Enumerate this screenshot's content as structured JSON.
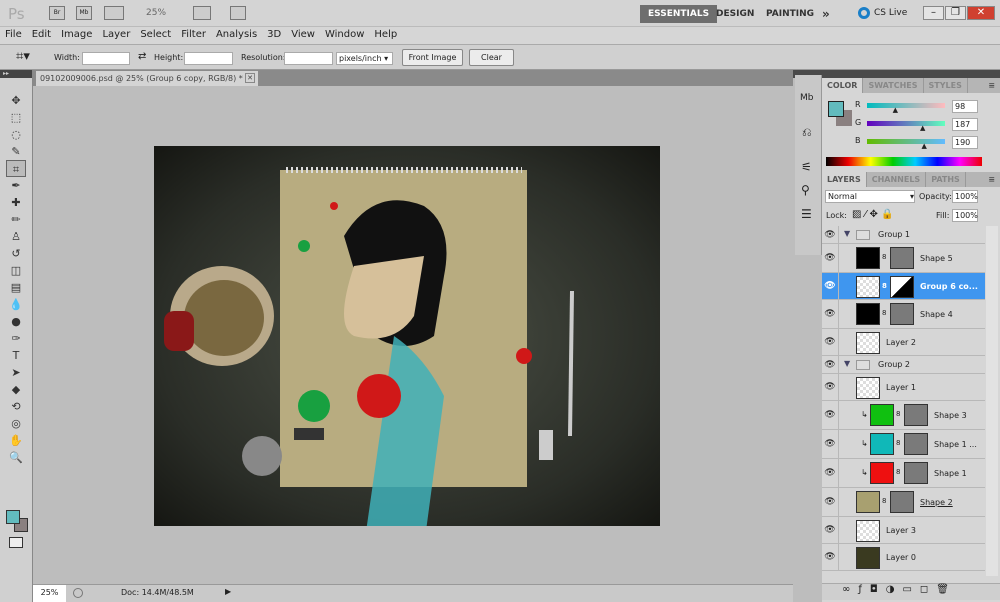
{
  "app": {
    "logo": "Ps",
    "bridge": "Br",
    "mini_bridge": "Mb",
    "zoom": "25%",
    "workspaces": [
      "ESSENTIALS",
      "DESIGN",
      "PAINTING"
    ],
    "more": "»",
    "cs_live": "CS Live"
  },
  "menu": [
    "File",
    "Edit",
    "Image",
    "Layer",
    "Select",
    "Filter",
    "Analysis",
    "3D",
    "View",
    "Window",
    "Help"
  ],
  "options": {
    "width_label": "Width:",
    "width_value": "",
    "height_label": "Height:",
    "height_value": "",
    "resolution_label": "Resolution:",
    "resolution_value": "",
    "unit": "pixels/inch",
    "front_image": "Front Image",
    "clear": "Clear"
  },
  "document": {
    "tab_title": "09102009006.psd @ 25% (Group 6 copy, RGB/8) *"
  },
  "status": {
    "zoom": "25%",
    "doc": "Doc: 14.4M/48.5M"
  },
  "tools": [
    "move",
    "marquee",
    "lasso",
    "quick-select",
    "crop",
    "eyedropper",
    "spot-heal",
    "brush",
    "stamp",
    "history-brush",
    "eraser",
    "gradient",
    "blur",
    "dodge",
    "pen",
    "type",
    "path-select",
    "shape",
    "3d-rotate",
    "3d-orbit",
    "hand",
    "zoom"
  ],
  "colors": {
    "foreground": "#62bbbe",
    "background": "#8a8080",
    "accent": "#3f96ef"
  },
  "color_panel": {
    "tabs": [
      "COLOR",
      "SWATCHES",
      "STYLES"
    ],
    "channels": [
      {
        "name": "R",
        "value": "98",
        "level": 0.38
      },
      {
        "name": "G",
        "value": "187",
        "level": 0.73
      },
      {
        "name": "B",
        "value": "190",
        "level": 0.75
      }
    ]
  },
  "layers_panel": {
    "tabs": [
      "LAYERS",
      "CHANNELS",
      "PATHS"
    ],
    "blend_mode": "Normal",
    "opacity_label": "Opacity:",
    "opacity": "100%",
    "lock_label": "Lock:",
    "fill_label": "Fill:",
    "fill": "100%",
    "layers": [
      {
        "name": "Group 1",
        "type": "group"
      },
      {
        "name": "Shape 5",
        "type": "shape",
        "fill": "#000000",
        "indent": 1
      },
      {
        "name": "Group 6 co...",
        "type": "smart",
        "indent": 1,
        "selected": true
      },
      {
        "name": "Shape 4",
        "type": "shape",
        "fill": "#000000",
        "indent": 1
      },
      {
        "name": "Layer 2",
        "type": "pixel",
        "indent": 1
      },
      {
        "name": "Group 2",
        "type": "group"
      },
      {
        "name": "Layer 1",
        "type": "pixel",
        "indent": 1
      },
      {
        "name": "Shape 3",
        "type": "shape",
        "fill": "#10c010",
        "indent": 2,
        "clipped": true
      },
      {
        "name": "Shape 1 ...",
        "type": "shape",
        "fill": "#10b8b8",
        "indent": 2,
        "clipped": true
      },
      {
        "name": "Shape 1",
        "type": "shape",
        "fill": "#ee1010",
        "indent": 2,
        "clipped": true
      },
      {
        "name": "Shape 2",
        "type": "shape",
        "fill": "#a8a070",
        "indent": 1
      },
      {
        "name": "Layer 3",
        "type": "pixel",
        "indent": 1
      },
      {
        "name": "Layer 0",
        "type": "photo",
        "indent": 1
      }
    ]
  }
}
